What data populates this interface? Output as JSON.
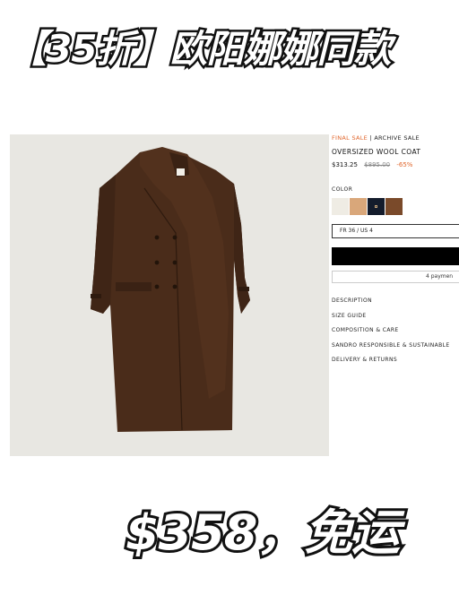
{
  "headline": "【35折】欧阳娜娜同款",
  "price_banner": "$358，免运",
  "product": {
    "sale_label": "FINAL SALE",
    "separator": " | ",
    "archive_label": "ARCHIVE SALE",
    "name": "OVERSIZED WOOL COAT",
    "current_price": "$313.25",
    "original_price": "$895.00",
    "discount": "-65%",
    "color_label": "COLOR",
    "colors": [
      {
        "name": "cream",
        "hex": "#efece4"
      },
      {
        "name": "camel",
        "hex": "#d9a77a"
      },
      {
        "name": "navy",
        "hex": "#141c2c"
      },
      {
        "name": "brown",
        "hex": "#7a4a2a"
      }
    ],
    "selected_color": 2,
    "size_selected": "FR 36 / US 4",
    "payment_text": "4 paymen",
    "links": [
      "DESCRIPTION",
      "SIZE GUIDE",
      "COMPOSITION & CARE",
      "SANDRO RESPONSIBLE & SUSTAINABLE",
      "DELIVERY & RETURNS"
    ]
  },
  "colors": {
    "sale_orange": "#e0662c",
    "coat_brown": "#4a2c1a",
    "photo_bg": "#e8e7e2"
  }
}
